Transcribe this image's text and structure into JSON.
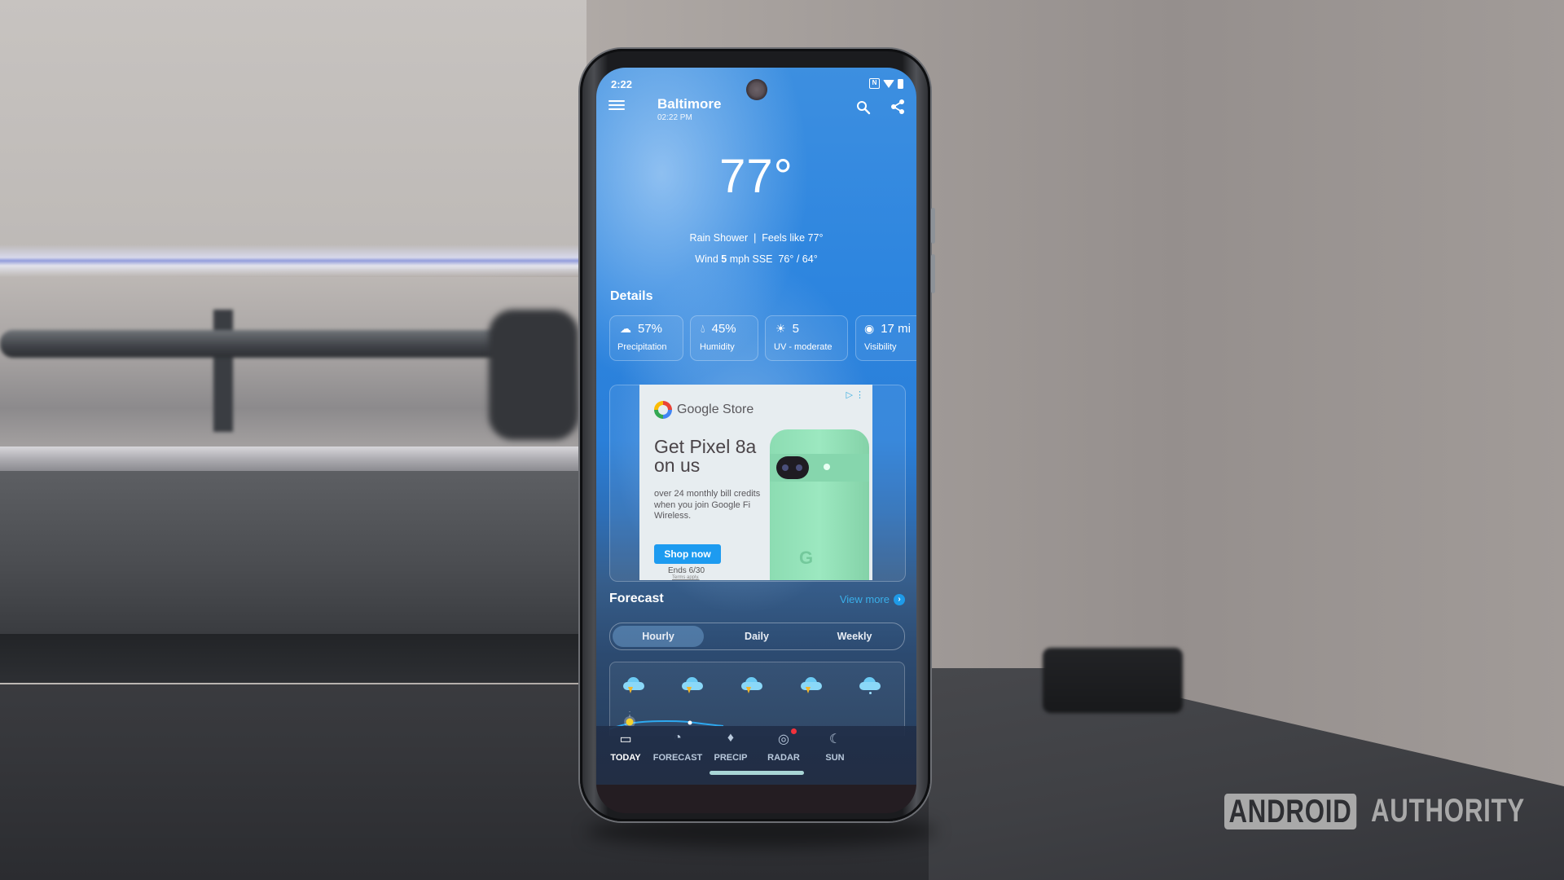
{
  "status_bar": {
    "time": "2:22",
    "icons": [
      "nfc-icon",
      "wifi-icon",
      "battery-icon"
    ]
  },
  "header": {
    "menu_icon": "menu-icon",
    "city": "Baltimore",
    "local_time": "02:22 PM",
    "actions": [
      "search-icon",
      "share-icon"
    ]
  },
  "current": {
    "temperature": "77°",
    "condition": "Rain Shower",
    "separator": "|",
    "feels_like": "Feels like 77°",
    "wind_prefix": "Wind",
    "wind_speed": "5",
    "wind_suffix": "mph SSE",
    "high_low": "76° / 64°"
  },
  "details": {
    "title": "Details",
    "cards": [
      {
        "icon": "rain-cloud-icon",
        "value": "57%",
        "label": "Precipitation"
      },
      {
        "icon": "water-drop-icon",
        "value": "45%",
        "label": "Humidity"
      },
      {
        "icon": "sun-icon",
        "value": "5",
        "label": "UV - moderate"
      },
      {
        "icon": "eye-icon",
        "value": "17 mi",
        "label": "Visibility"
      }
    ]
  },
  "ad": {
    "brand": "Google Store",
    "headline": "Get Pixel 8a on us",
    "body": "over 24 monthly bill credits when you join Google Fi Wireless.",
    "cta": "Shop now",
    "ends": "Ends 6/30",
    "terms": "Terms apply.",
    "adchoices": "▷ ⋮"
  },
  "forecast": {
    "title": "Forecast",
    "view_more": "View more",
    "tabs": [
      {
        "label": "Hourly",
        "active": true
      },
      {
        "label": "Daily",
        "active": false
      },
      {
        "label": "Weekly",
        "active": false
      }
    ],
    "hourly_icons": [
      "thunderstorm-icon",
      "thunderstorm-icon",
      "thunderstorm-icon",
      "thunderstorm-icon",
      "rain-icon"
    ]
  },
  "bottom_nav": [
    {
      "label": "TODAY",
      "icon": "calendar-icon",
      "active": true
    },
    {
      "label": "FORECAST",
      "icon": "clock-icon",
      "active": false
    },
    {
      "label": "PRECIP",
      "icon": "drop-icon",
      "active": false
    },
    {
      "label": "RADAR",
      "icon": "radar-icon",
      "active": false,
      "badge": true
    },
    {
      "label": "SUN",
      "icon": "sun-moon-icon",
      "active": false
    }
  ],
  "watermark": {
    "boxed": "ANDROID",
    "plain": "AUTHORITY"
  },
  "colors": {
    "accent_blue": "#1e9ae8",
    "cta_blue": "#1d9bf0",
    "badge_red": "#f2323c",
    "bolt_yellow": "#f3b62b"
  }
}
